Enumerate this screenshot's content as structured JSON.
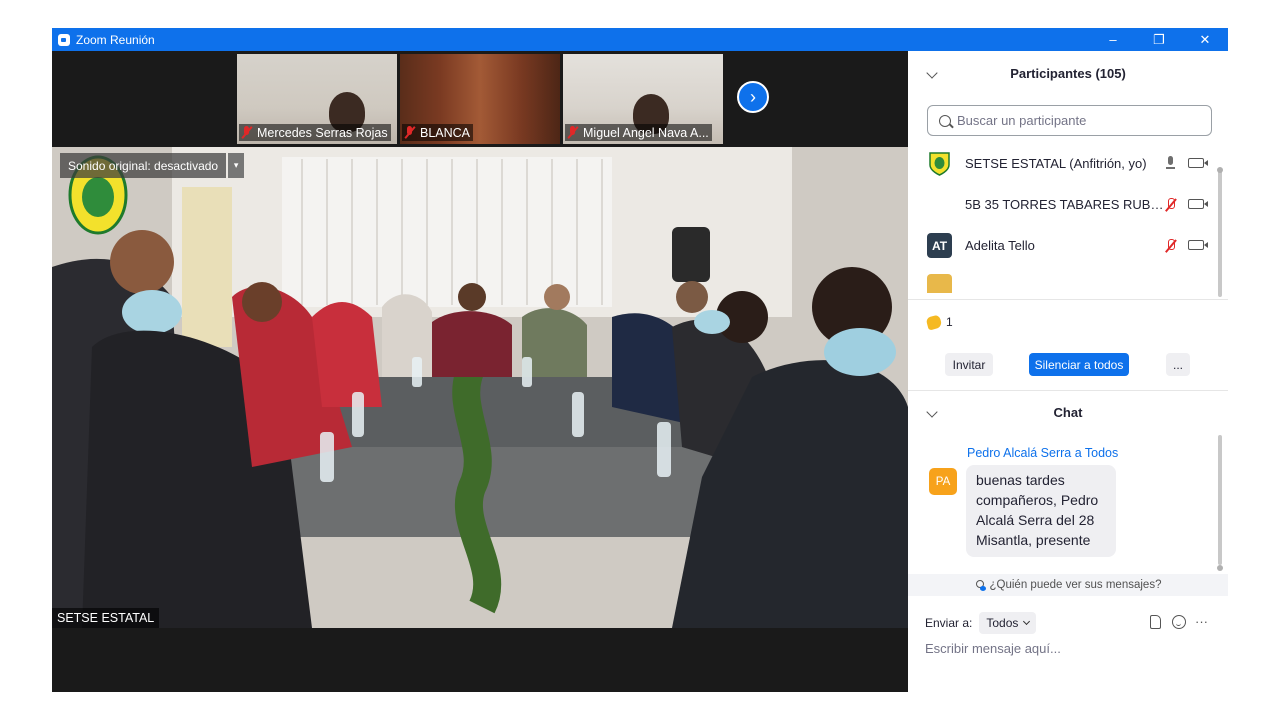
{
  "window": {
    "title": "Zoom Reunión",
    "controls": {
      "minimize": "–",
      "restore": "❐",
      "close": "✕"
    }
  },
  "thumbnails": [
    {
      "name": "Mercedes Serras Rojas",
      "muted": true
    },
    {
      "name": "BLANCA",
      "muted": true
    },
    {
      "name": "Miguel Angel Nava A...",
      "muted": true
    }
  ],
  "next_page_icon": "chevron-right-icon",
  "main_video": {
    "sound_pill": "Sonido original: desactivado",
    "speaker_name": "SETSE ESTATAL"
  },
  "participants_panel": {
    "title": "Participantes (105)",
    "search_placeholder": "Buscar un participante",
    "participants": [
      {
        "name": "SETSE ESTATAL (Anfitrión, yo)",
        "avatar": "logo",
        "mic": "on",
        "camera": "off"
      },
      {
        "name": "5B 35 TORRES TABARES RUBEN ...",
        "avatar": "",
        "mic": "muted",
        "camera": "off"
      },
      {
        "name": "Adelita Tello",
        "avatar": "AT",
        "mic": "muted",
        "camera": "off"
      }
    ],
    "reaction_count": "1",
    "buttons": {
      "invite": "Invitar",
      "mute_all": "Silenciar a todos",
      "more": "..."
    }
  },
  "chat": {
    "title": "Chat",
    "messages": [
      {
        "from": "Pedro Alcalá Serra a Todos",
        "avatar": "PA",
        "text": "buenas tardes compañeros, Pedro Alcalá Serra del 28 Misantla, presente"
      }
    ],
    "who_can_see": "¿Quién puede ver sus mensajes?",
    "send_to_label": "Enviar a:",
    "send_to_value": "Todos",
    "input_placeholder": "Escribir mensaje aquí...",
    "more": "···"
  },
  "colors": {
    "accent": "#0e71eb",
    "muted_red": "#e02828",
    "avatar_orange": "#f7a21b",
    "avatar_dark": "#2d3e50"
  }
}
